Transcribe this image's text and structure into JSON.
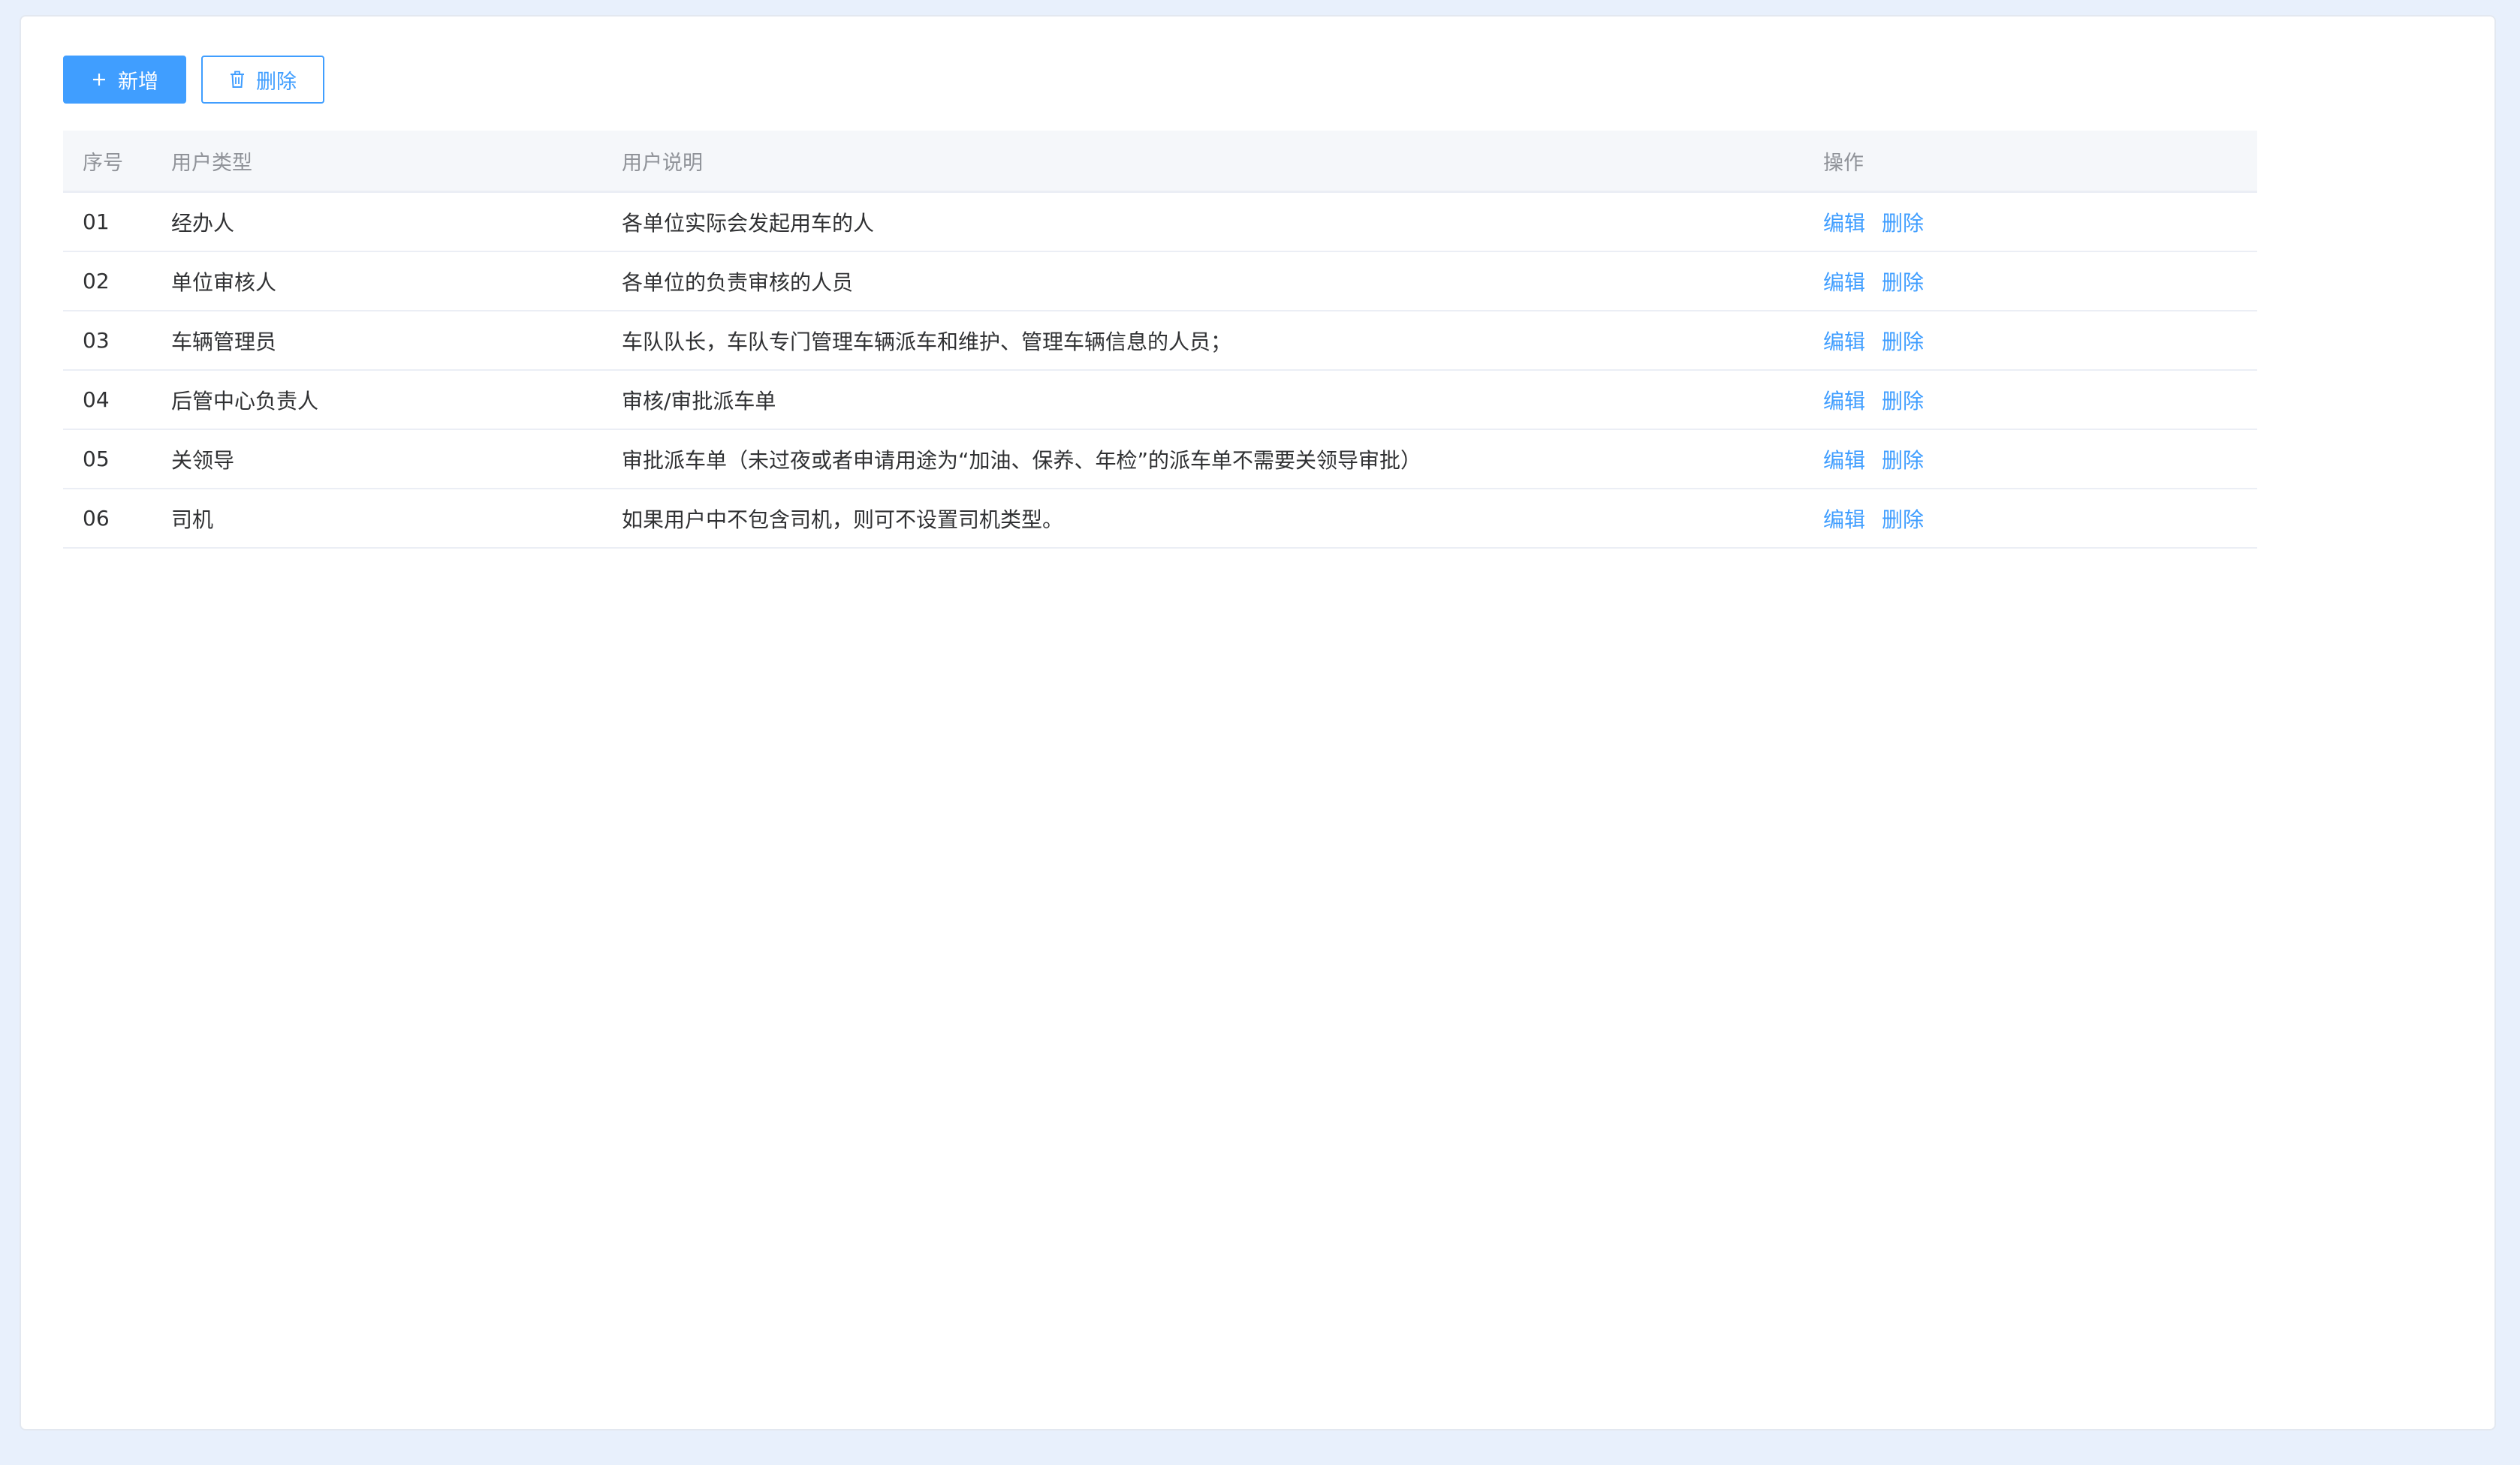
{
  "toolbar": {
    "add_label": "新增",
    "delete_label": "删除"
  },
  "table": {
    "headers": [
      "序号",
      "用户类型",
      "用户说明",
      "操作"
    ],
    "rows": [
      {
        "no": "01",
        "type": "经办人",
        "desc": "各单位实际会发起用车的人",
        "edit": "编辑",
        "delete": "删除"
      },
      {
        "no": "02",
        "type": "单位审核人",
        "desc": "各单位的负责审核的人员",
        "edit": "编辑",
        "delete": "删除"
      },
      {
        "no": "03",
        "type": "车辆管理员",
        "desc": "车队队长，车队专门管理车辆派车和维护、管理车辆信息的人员；",
        "edit": "编辑",
        "delete": "删除"
      },
      {
        "no": "04",
        "type": "后管中心负责人",
        "desc": "审核/审批派车单",
        "edit": "编辑",
        "delete": "删除"
      },
      {
        "no": "05",
        "type": "关领导",
        "desc": "审批派车单（未过夜或者申请用途为“加油、保养、年检”的派车单不需要关领导审批）",
        "edit": "编辑",
        "delete": "删除"
      },
      {
        "no": "06",
        "type": "司机",
        "desc": "如果用户中不包含司机，则可不设置司机类型。",
        "edit": "编辑",
        "delete": "删除"
      }
    ]
  },
  "colors": {
    "accent": "#409eff",
    "page_bg": "#e8f0fc",
    "header_bg": "#f5f7fa"
  }
}
